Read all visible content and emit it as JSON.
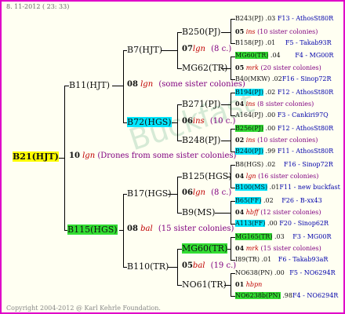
{
  "header": {
    "date": "8. 11-2012 ( 23: 33)"
  },
  "footer": {
    "copyright": "Copyright 2004-2012 @ Karl Kehrle Foundation."
  },
  "watermark": "Buckfast",
  "root": {
    "name": "B21(HJT)",
    "year": "10",
    "race": "lgn",
    "note": "(Drones from some sister colonies)"
  },
  "gen2": [
    {
      "name": "B11(HJT)",
      "year": "08",
      "race": "lgn",
      "note": "(some sister colonies)"
    },
    {
      "name": "B115(HGS)",
      "year": "08",
      "race": "bal",
      "note": "(15 sister colonies)"
    }
  ],
  "gen3": [
    {
      "name": "B7(HJT)",
      "year": "07",
      "race": "lgn",
      "note": "(8 c.)"
    },
    {
      "name": "B72(HGS)",
      "year": "06",
      "race": "ins",
      "note": "(10 c.)"
    },
    {
      "name": "B17(HGS)",
      "year": "06",
      "race": "lgn",
      "note": "(8 c.)"
    },
    {
      "name": "B110(TR)",
      "year": "05",
      "race": "bal",
      "note": "(19 c.)"
    }
  ],
  "gen4": [
    {
      "name": "B250(PJ)"
    },
    {
      "name": "MG62(TR)"
    },
    {
      "name": "B271(PJ)"
    },
    {
      "name": "B248(PJ)"
    },
    {
      "name": "B125(HGS)"
    },
    {
      "name": "B9(MS)"
    },
    {
      "name": "MG60(TR)"
    },
    {
      "name": "NO61(TR)"
    }
  ],
  "gen5": [
    {
      "name": "B243(PJ)",
      "year": ".03",
      "info": "F13 - AthosSt80R"
    },
    {
      "name": "05",
      "race": "ins",
      "info": "(10 sister colonies)"
    },
    {
      "name": "B158(PJ)",
      "year": ".01",
      "info": "F5 - Takab93R"
    },
    {
      "name": "MG60(TR)",
      "year": ".04",
      "info": "F4 - MG00R"
    },
    {
      "name": "05",
      "race": "mrk",
      "info": "(20 sister colonies)"
    },
    {
      "name": "B40(MKW)",
      "year": ".02",
      "info": "F16 - Sinop72R"
    },
    {
      "name": "B194(PJ)",
      "year": ".02",
      "info": "F12 - AthosSt80R"
    },
    {
      "name": "04",
      "race": "ins",
      "info": "(8 sister colonies)"
    },
    {
      "name": "A164(PJ)",
      "year": ".00",
      "info": "F3 - Cankiri97Q"
    },
    {
      "name": "B256(PJ)",
      "year": ".00",
      "info": "F12 - AthosSt80R"
    },
    {
      "name": "02",
      "race": "ins",
      "info": "(10 sister colonies)"
    },
    {
      "name": "B240(PJ)",
      "year": ".99",
      "info": "F11 - AthosSt80R"
    },
    {
      "name": "B8(HGS)",
      "year": ".02",
      "info": "F16 - Sinop72R"
    },
    {
      "name": "04",
      "race": "lgn",
      "info": "(16 sister colonies)"
    },
    {
      "name": "B100(MS)",
      "year": ".01",
      "info": "F11 - new buckfast"
    },
    {
      "name": "B65(FF)",
      "year": ".02",
      "info": "F26 - B-xx43"
    },
    {
      "name": "04",
      "race": "hbff",
      "info": "(12 sister colonies)"
    },
    {
      "name": "A113(FF)",
      "year": ".00",
      "info": "F20 - Sinop62R"
    },
    {
      "name": "MG165(TR)",
      "year": ".03",
      "info": "F3 - MG00R"
    },
    {
      "name": "04",
      "race": "mrk",
      "info": "(15 sister colonies)"
    },
    {
      "name": "I89(TR)",
      "year": ".01",
      "info": "F6 - Takab93aR"
    },
    {
      "name": "NO638(PN)",
      "year": ".00",
      "info": "F5 - NO6294R"
    },
    {
      "name": "01",
      "race": "hbpn",
      "info": ""
    },
    {
      "name": "NO6238b(PN)",
      "year": ".98",
      "info": "F4 - NO6294R"
    }
  ]
}
